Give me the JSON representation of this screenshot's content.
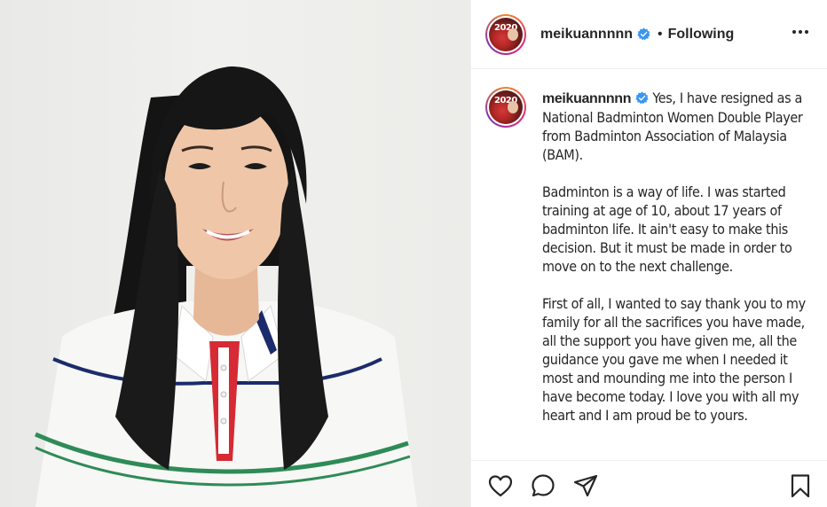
{
  "post": {
    "username": "meikuannnnn",
    "follow_status": "Following",
    "separator": "•",
    "avatar_badge_text": "2020",
    "caption_paragraphs": [
      "Yes, I have resigned as a National Badminton Women Double Player from Badminton Association of Malaysia (BAM).",
      "Badminton is a way of life. I was started training at age of 10, about 17 years of badminton life. It ain't easy to make this decision. But it must be made in order to move on to the next challenge.",
      "First of all, I wanted to say thank you to my family for all the sacrifices you have made, all the support you have given me, all the guidance you gave me when I needed it most and mounding me into the person I have become today. I love you with all my heart and I am proud be to yours."
    ]
  },
  "icons": {
    "verified": "verified-badge-icon",
    "more": "more-options-icon",
    "like": "heart-icon",
    "comment": "comment-icon",
    "share": "share-icon",
    "save": "bookmark-icon"
  },
  "colors": {
    "verified_blue": "#3897f0",
    "text": "#262626",
    "divider": "#efefef",
    "shirt_red": "#d62a35",
    "shirt_navy": "#1c2b6b",
    "shirt_green": "#2e8b57"
  }
}
